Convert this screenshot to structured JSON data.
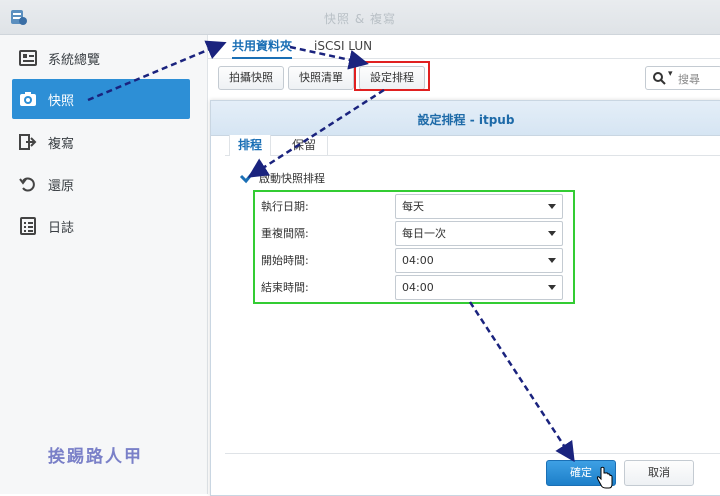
{
  "window": {
    "title": "快照 & 複寫"
  },
  "sidebar": {
    "items": [
      {
        "label": "系統總覽",
        "icon": "overview-icon",
        "active": false
      },
      {
        "label": "快照",
        "icon": "camera-icon",
        "active": true
      },
      {
        "label": "複寫",
        "icon": "replication-icon",
        "active": false
      },
      {
        "label": "還原",
        "icon": "restore-icon",
        "active": false
      },
      {
        "label": "日誌",
        "icon": "log-icon",
        "active": false
      }
    ]
  },
  "top_tabs": [
    {
      "label": "共用資料夾"
    },
    {
      "label": "iSCSI LUN"
    }
  ],
  "toolbar": {
    "take_snapshot": "拍攝快照",
    "snapshot_list": "快照清單",
    "set_schedule": "設定排程"
  },
  "search": {
    "placeholder": "搜尋"
  },
  "dialog": {
    "title": "設定排程 - itpub",
    "tabs": [
      {
        "label": "排程"
      },
      {
        "label": "保留"
      }
    ],
    "enable_label": "啟動快照排程",
    "rows": [
      {
        "label": "執行日期:",
        "value": "每天"
      },
      {
        "label": "重複間隔:",
        "value": "每日一次"
      },
      {
        "label": "開始時間:",
        "value": "04:00"
      },
      {
        "label": "結束時間:",
        "value": "04:00"
      }
    ],
    "ok_label": "確定",
    "cancel_label": "取消"
  },
  "watermark": "挨踢路人甲",
  "colors": {
    "accent": "#2d8fd6",
    "highlight_red": "#e02020",
    "highlight_green": "#33cc33",
    "arrow": "#1a237e"
  }
}
